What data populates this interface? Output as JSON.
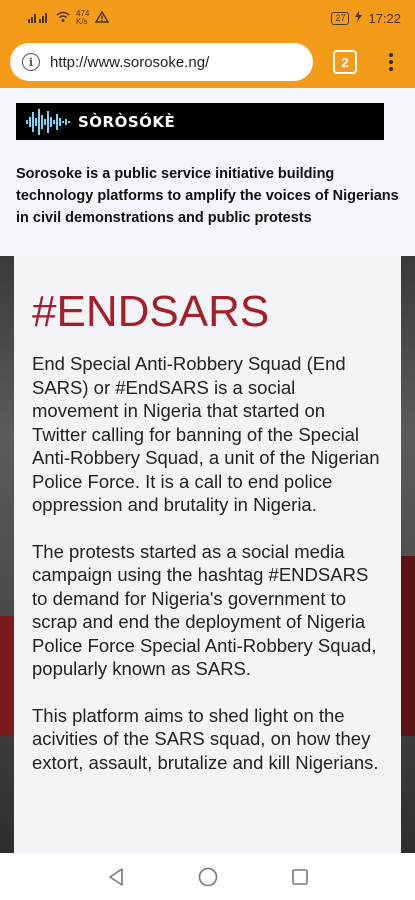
{
  "status_bar": {
    "left_icons": [
      "signal-icon",
      "wifi-icon"
    ],
    "speed_value": "474",
    "speed_unit": "K/s",
    "alert_icon": "alert-icon",
    "battery": "27",
    "time": "17:22"
  },
  "browser": {
    "url": "http://www.sorosoke.ng/",
    "tab_count": "2",
    "colors": {
      "toolbar": "#f59b1a"
    }
  },
  "site": {
    "logo_text": "SÒRÒSÓKÈ",
    "intro": "Sorosoke is a public service initiative building technology platforms to amplify the voices of Nigerians in civil demonstrations and public protests"
  },
  "card": {
    "title": "#ENDSARS",
    "title_color": "#a3202a",
    "paragraphs": [
      "End Special Anti-Robbery Squad (End SARS) or #EndSARS is a social movement in Nigeria that started on Twitter calling for banning of the Special Anti-Robbery Squad, a unit of the Nigerian Police Force. It is a call to end police oppression and brutality in Nigeria.",
      "The protests started as a social media campaign using the hashtag #ENDSARS to demand for Nigeria's government to scrap and end the deployment of Nigeria Police Force Special Anti-Robbery Squad, popularly known as SARS.",
      "This platform aims to shed light on the acivities of the SARS squad, on how they extort, assault, brutalize and kill Nigerians."
    ]
  },
  "nav_bar": {
    "buttons": [
      "back-icon",
      "home-icon",
      "recents-icon"
    ]
  }
}
